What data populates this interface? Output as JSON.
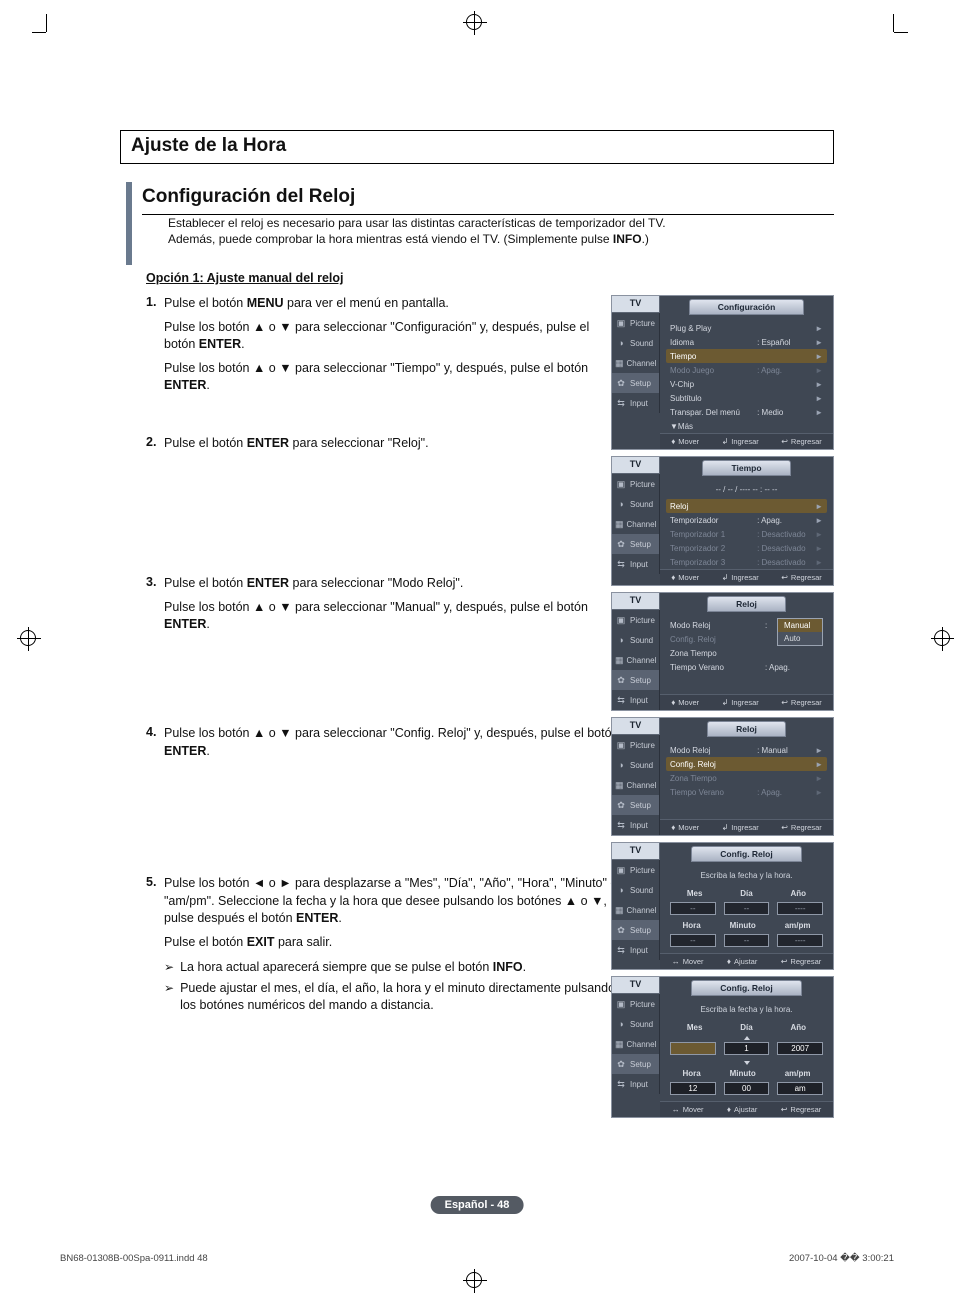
{
  "crop_marks": true,
  "main_title": "Ajuste de la Hora",
  "sub_title": "Configuración del Reloj",
  "intro_l1": "Establecer el reloj es necesario para usar las distintas características de temporizador del TV.",
  "intro_l2_a": "Además, puede comprobar la hora mientras está viendo el TV. (Simplemente pulse ",
  "intro_l2_b": "INFO",
  "intro_l2_c": ".)",
  "option_heading": "Opción 1: Ajuste manual del reloj",
  "symbols": {
    "up": "▲",
    "down": "▼",
    "left": "◄",
    "right": "►",
    "updown": "♦",
    "leftright": "↔",
    "enter": "↲",
    "back": "↩",
    "note_arrow": "➢"
  },
  "step1": {
    "num": "1.",
    "t1a": "Pulse el botón ",
    "t1b": "MENU",
    "t1c": " para ver el menú en pantalla.",
    "t2a": "Pulse los botón ▲ o ▼ para seleccionar \"Configuración\" y, después, pulse el botón ",
    "t2b": "ENTER",
    "t2c": ".",
    "t3a": "Pulse los botón ▲ o ▼ para seleccionar \"Tiempo\" y, después, pulse el botón ",
    "t3b": "ENTER",
    "t3c": "."
  },
  "step2": {
    "num": "2.",
    "t1a": "Pulse el botón ",
    "t1b": "ENTER",
    "t1c": " para seleccionar \"Reloj\"."
  },
  "step3": {
    "num": "3.",
    "t1a": "Pulse el botón ",
    "t1b": "ENTER",
    "t1c": " para seleccionar \"Modo Reloj\".",
    "t2a": "Pulse los botón ▲ o ▼ para seleccionar \"Manual\" y, después, pulse el botón ",
    "t2b": "ENTER",
    "t2c": "."
  },
  "step4": {
    "num": "4.",
    "t1a": "Pulse los botón ▲ o ▼ para seleccionar \"Config. Reloj\" y, después, pulse el botón ",
    "t1b": "ENTER",
    "t1c": "."
  },
  "step5": {
    "num": "5.",
    "t1": "Pulse los botón ◄ o ► para desplazarse a \"Mes\", \"Día\", \"Año\", \"Hora\", \"Minuto\" o \"am/pm\". Seleccione la fecha y la hora que desee pulsando los botónes ▲ o ▼, pulse después el botón ",
    "t1b": "ENTER",
    "t1c": ".",
    "t2a": "Pulse el botón ",
    "t2b": "EXIT",
    "t2c": " para salir.",
    "note1a": "La hora actual aparecerá siempre que se pulse el botón ",
    "note1b": "INFO",
    "note1c": ".",
    "note2": "Puede ajustar el mes, el día, el año, la hora y el minuto directamente pulsando los botónes numéricos del mando a distancia."
  },
  "side": {
    "tv": "TV",
    "items": [
      {
        "icon": "▣",
        "label": "Picture"
      },
      {
        "icon": "◑",
        "label": "Sound"
      },
      {
        "icon": "▦",
        "label": "Channel"
      },
      {
        "icon": "✿",
        "label": "Setup"
      },
      {
        "icon": "⇆",
        "label": "Input"
      }
    ]
  },
  "osd1": {
    "title": "Configuración",
    "rows": [
      {
        "lbl": "Plug & Play",
        "val": "",
        "chev": "►"
      },
      {
        "lbl": "Idioma",
        "val": ": Español",
        "chev": "►"
      },
      {
        "lbl": "Tiempo",
        "val": "",
        "chev": "►",
        "hl": true
      },
      {
        "lbl": "Modo Juego",
        "val": ": Apag.",
        "chev": "►",
        "dim": true
      },
      {
        "lbl": "V-Chip",
        "val": "",
        "chev": "►"
      },
      {
        "lbl": "Subtítulo",
        "val": "",
        "chev": "►"
      },
      {
        "lbl": "Transpar. Del menú",
        "val": ": Medio",
        "chev": "►"
      },
      {
        "lbl": "▼Más",
        "val": "",
        "chev": ""
      }
    ]
  },
  "osd2": {
    "title": "Tiempo",
    "clock": "-- / -- / ----    -- : --  --",
    "rows": [
      {
        "lbl": "Reloj",
        "val": "",
        "chev": "►",
        "hl": true
      },
      {
        "lbl": "Temporizador",
        "val": ": Apag.",
        "chev": "►"
      },
      {
        "lbl": "Temporizador 1",
        "val": ": Desactivado",
        "chev": "►",
        "dim": true
      },
      {
        "lbl": "Temporizador 2",
        "val": ": Desactivado",
        "chev": "►",
        "dim": true
      },
      {
        "lbl": "Temporizador 3",
        "val": ": Desactivado",
        "chev": "►",
        "dim": true
      }
    ]
  },
  "osd3": {
    "title": "Reloj",
    "rows": [
      {
        "lbl": "Modo Reloj",
        "val": ":",
        "chev": ""
      },
      {
        "lbl": "Config. Reloj",
        "val": "",
        "chev": "",
        "dim": true
      },
      {
        "lbl": "Zona Tiempo",
        "val": "",
        "chev": ""
      },
      {
        "lbl": "Tiempo Verano",
        "val": ": Apag.",
        "chev": ""
      }
    ],
    "drop": [
      "Manual",
      "Auto"
    ],
    "drop_sel": 0
  },
  "osd4": {
    "title": "Reloj",
    "rows": [
      {
        "lbl": "Modo Reloj",
        "val": ": Manual",
        "chev": "►"
      },
      {
        "lbl": "Config. Reloj",
        "val": "",
        "chev": "►",
        "hl": true
      },
      {
        "lbl": "Zona Tiempo",
        "val": "",
        "chev": "►",
        "dim": true
      },
      {
        "lbl": "Tiempo Verano",
        "val": ": Apag.",
        "chev": "►",
        "dim": true
      }
    ]
  },
  "osd5": {
    "title": "Config. Reloj",
    "help": "Escriba la fecha y la hora.",
    "h1": [
      "Mes",
      "Día",
      "Año"
    ],
    "r1": [
      "--",
      "--",
      "----"
    ],
    "h2": [
      "Hora",
      "Minuto",
      "am/pm"
    ],
    "r2": [
      "--",
      "--",
      "----"
    ]
  },
  "osd6": {
    "title": "Config. Reloj",
    "help": "Escriba la fecha y la hora.",
    "h1": [
      "Mes",
      "Día",
      "Año"
    ],
    "r1": [
      "",
      "1",
      "2007"
    ],
    "focus_idx": 0,
    "h2": [
      "Hora",
      "Minuto",
      "am/pm"
    ],
    "r2": [
      "12",
      "00",
      "am"
    ]
  },
  "foot_std": {
    "move": "Mover",
    "enter": "Ingresar",
    "back": "Regresar"
  },
  "foot_adj": {
    "move": "Mover",
    "adjust": "Ajustar",
    "back": "Regresar"
  },
  "page_number": "Español - 48",
  "doc_id": "BN68-01308B-00Spa-0911.indd   48",
  "doc_date": "2007-10-04   �� 3:00:21"
}
